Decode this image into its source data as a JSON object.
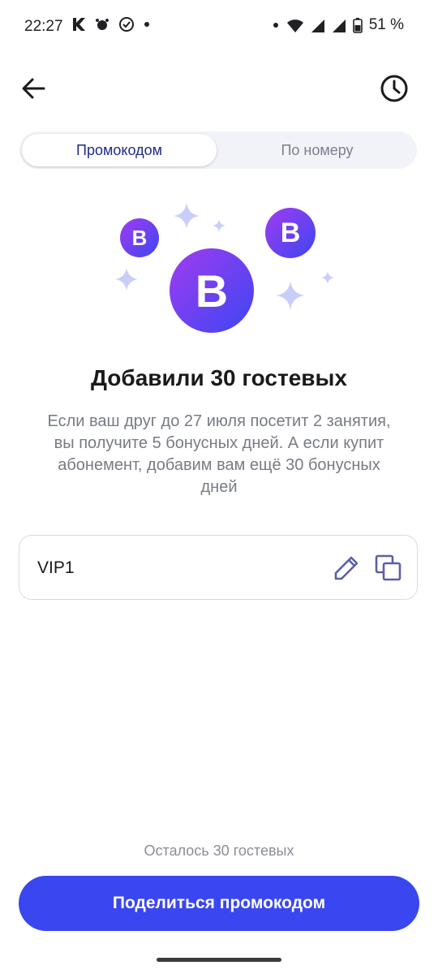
{
  "status_bar": {
    "time": "22:27",
    "battery": "51 %"
  },
  "header": {
    "back_icon": "arrow-left-icon",
    "history_icon": "clock-icon"
  },
  "tabs": [
    {
      "label": "Промокодом",
      "active": true
    },
    {
      "label": "По номеру",
      "active": false
    }
  ],
  "illustration": {
    "badge_letter": "B",
    "colors": {
      "badge_start": "#8b3cf2",
      "badge_end": "#3d46f2",
      "sparkle": "#c9cdf8"
    }
  },
  "content": {
    "headline": "Добавили 30 гостевых",
    "description": "Если ваш друг до 27 июля посетит 2 занятия, вы получите 5 бонусных дней. А если купит абонемент, добавим вам ещё 30 бонусных дней"
  },
  "promo": {
    "code": "VIP1",
    "edit_icon": "pencil-icon",
    "copy_icon": "copy-icon"
  },
  "footer": {
    "remaining": "Осталось 30 гостевых",
    "share_label": "Поделиться промокодом",
    "accent": "#3a46f0"
  }
}
